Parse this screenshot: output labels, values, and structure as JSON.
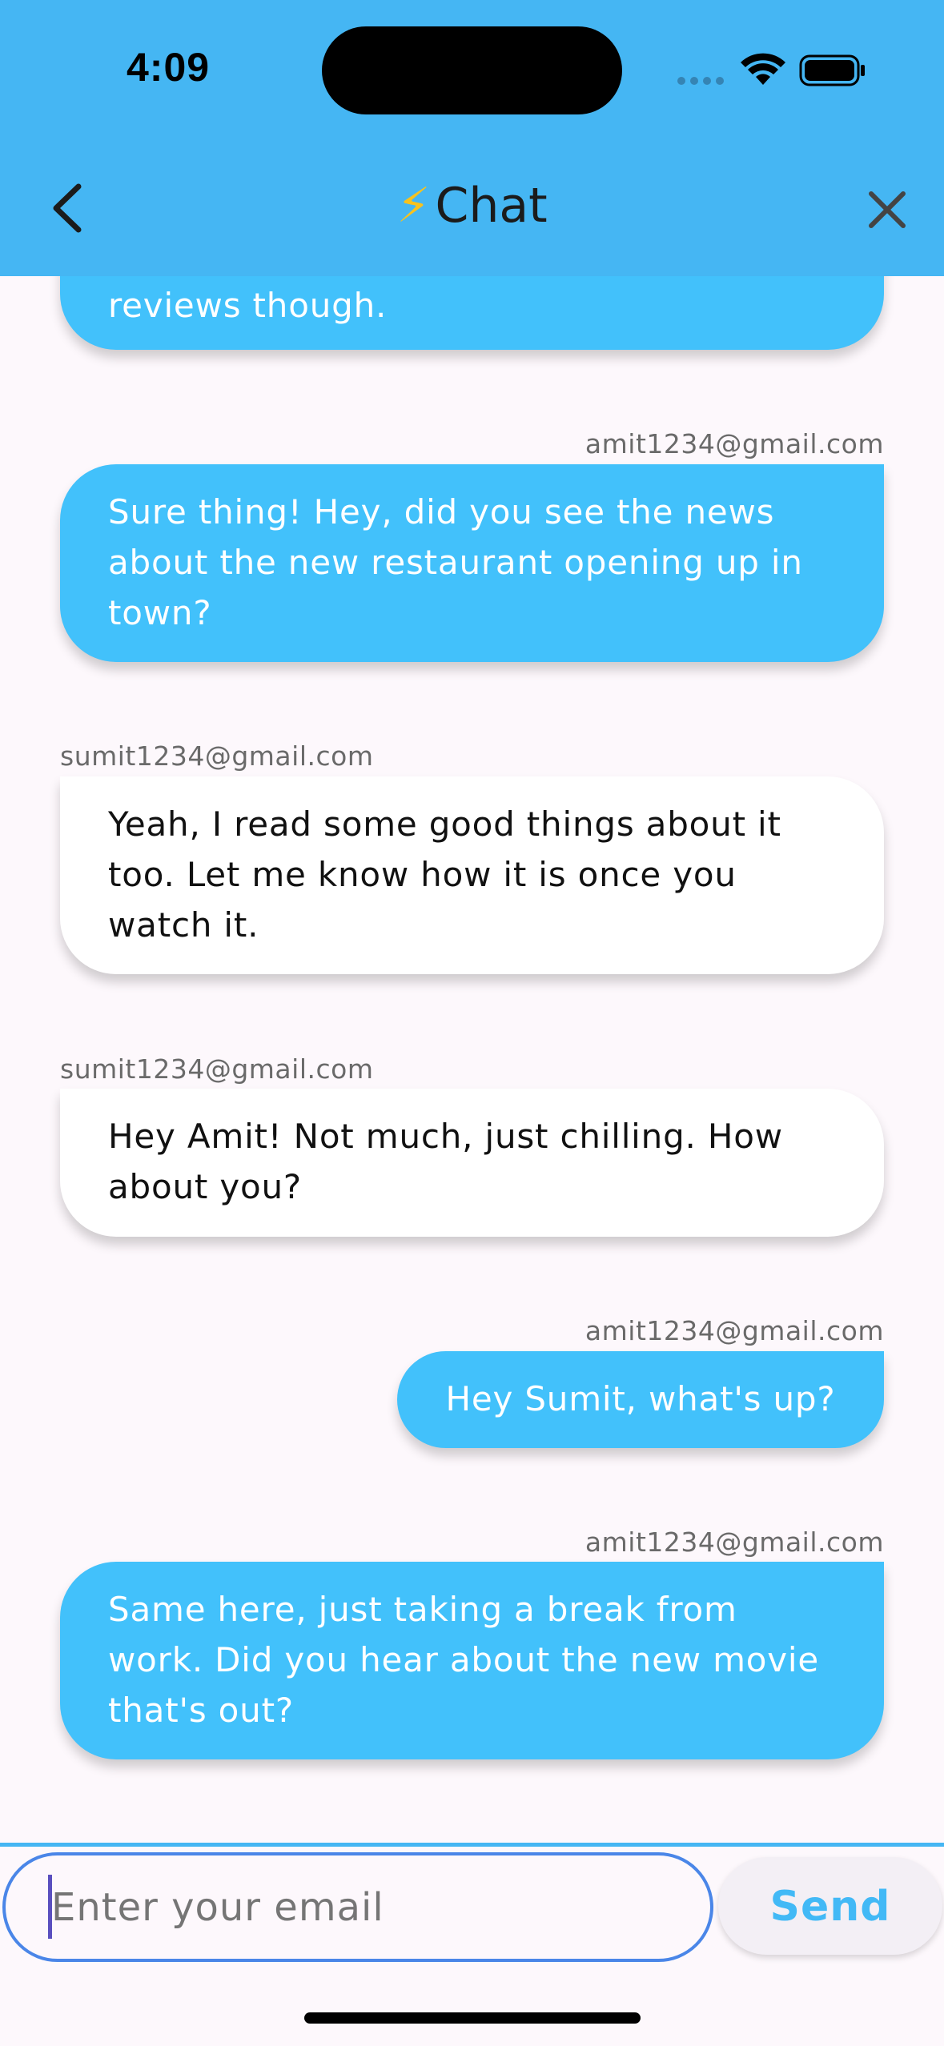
{
  "status_bar": {
    "time": "4:09"
  },
  "header": {
    "title": "Chat",
    "title_icon": "lightning-bolt-icon",
    "back_icon": "chevron-left-icon",
    "close_icon": "close-icon"
  },
  "colors": {
    "header": "#45b6f3",
    "my_bubble": "#42c1fb",
    "their_bubble": "#ffffff",
    "send_text": "#42b9f6",
    "input_border": "#4a86e8"
  },
  "messages": [
    {
      "sender": "",
      "text": "reviews though.",
      "mine": true
    },
    {
      "sender": "amit1234@gmail.com",
      "text": "Sure thing! Hey, did you see the news about the new restaurant opening up in town?",
      "mine": true
    },
    {
      "sender": "sumit1234@gmail.com",
      "text": "Yeah, I read some good things about it too. Let me know how it is once you watch it.",
      "mine": false
    },
    {
      "sender": "sumit1234@gmail.com",
      "text": "Hey Amit! Not much, just chilling. How about you?",
      "mine": false
    },
    {
      "sender": "amit1234@gmail.com",
      "text": "Hey Sumit, what's up?",
      "mine": true
    },
    {
      "sender": "amit1234@gmail.com",
      "text": "Same here, just taking a break from work. Did you hear about the new movie that's out?",
      "mine": true
    }
  ],
  "composer": {
    "placeholder": "Enter your email",
    "value": "",
    "send_label": "Send"
  }
}
